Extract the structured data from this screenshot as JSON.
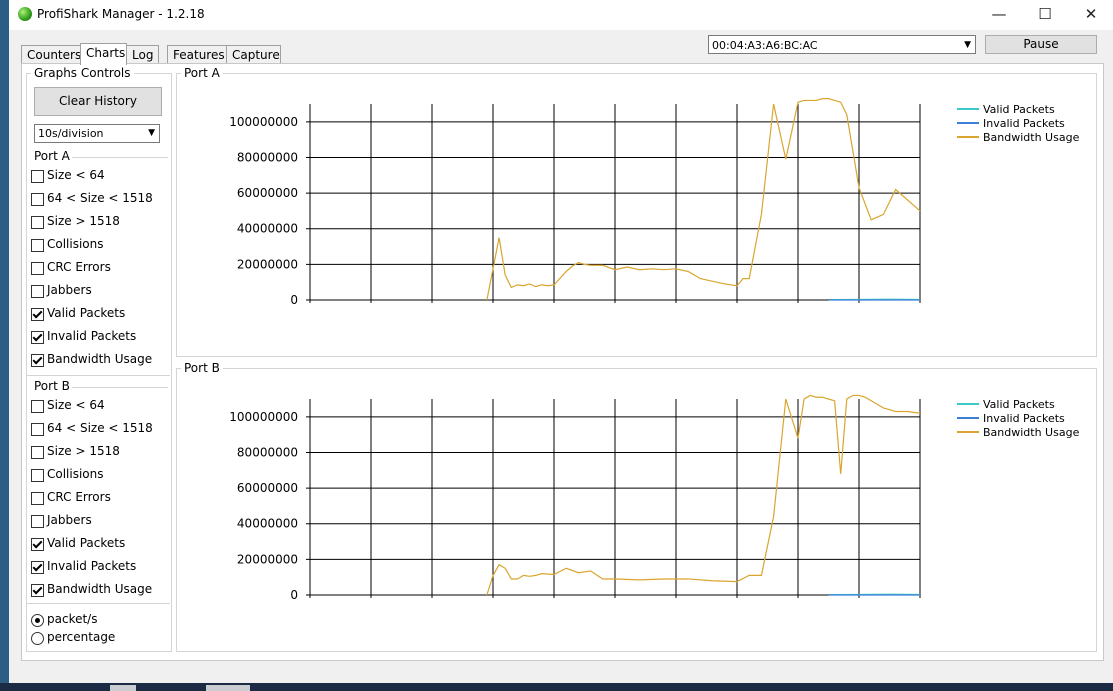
{
  "window": {
    "title": "ProfiShark Manager - 1.2.18"
  },
  "tabs": [
    {
      "label": "Counters",
      "active": false
    },
    {
      "label": "Charts",
      "active": true
    },
    {
      "label": "Log",
      "active": false
    },
    {
      "label": "Features",
      "active": false
    },
    {
      "label": "Capture",
      "active": false
    }
  ],
  "device_select": {
    "value": "00:04:A3:A6:BC:AC"
  },
  "pause_label": "Pause",
  "controls": {
    "group_title": "Graphs Controls",
    "clear_history": "Clear History",
    "division_select": "10s/division",
    "port_a": {
      "label": "Port A",
      "items": [
        {
          "label": "Size < 64",
          "checked": false
        },
        {
          "label": "64 < Size < 1518",
          "checked": false
        },
        {
          "label": "Size > 1518",
          "checked": false
        },
        {
          "label": "Collisions",
          "checked": false
        },
        {
          "label": "CRC Errors",
          "checked": false
        },
        {
          "label": "Jabbers",
          "checked": false
        },
        {
          "label": "Valid Packets",
          "checked": true
        },
        {
          "label": "Invalid Packets",
          "checked": true
        },
        {
          "label": "Bandwidth Usage",
          "checked": true
        }
      ]
    },
    "port_b": {
      "label": "Port B",
      "items": [
        {
          "label": "Size < 64",
          "checked": false
        },
        {
          "label": "64 < Size < 1518",
          "checked": false
        },
        {
          "label": "Size > 1518",
          "checked": false
        },
        {
          "label": "Collisions",
          "checked": false
        },
        {
          "label": "CRC Errors",
          "checked": false
        },
        {
          "label": "Jabbers",
          "checked": false
        },
        {
          "label": "Valid Packets",
          "checked": true
        },
        {
          "label": "Invalid Packets",
          "checked": true
        },
        {
          "label": "Bandwidth Usage",
          "checked": true
        }
      ]
    },
    "units": [
      {
        "label": "packet/s",
        "selected": true
      },
      {
        "label": "percentage",
        "selected": false
      }
    ]
  },
  "colors": {
    "valid": "#3cc8c8",
    "invalid": "#3c7fd8",
    "bandwidth": "#d9a52e"
  },
  "chart_data": [
    {
      "type": "line",
      "title": "Port A",
      "ylim": [
        0,
        110000000
      ],
      "yticks": [
        0,
        20000000,
        40000000,
        60000000,
        80000000,
        100000000
      ],
      "ytick_labels": [
        "0",
        "20000000",
        "40000000",
        "60000000",
        "80000000",
        "100000000"
      ],
      "xlim": [
        0,
        100
      ],
      "grid": true,
      "legend": "top-right",
      "series": [
        {
          "name": "Valid Packets",
          "color": "#3cc8c8",
          "x": [
            85,
            90,
            95,
            100
          ],
          "y": [
            200000,
            300000,
            400000,
            300000
          ]
        },
        {
          "name": "Invalid Packets",
          "color": "#3c7fd8",
          "x": [
            85,
            100
          ],
          "y": [
            0,
            0
          ]
        },
        {
          "name": "Bandwidth Usage",
          "color": "#d9a52e",
          "x": [
            29,
            31,
            32,
            33,
            34,
            35,
            36,
            37,
            38,
            39,
            40,
            42,
            43,
            44,
            45,
            46,
            47,
            48,
            50,
            52,
            54,
            56,
            58,
            60,
            62,
            64,
            66,
            68,
            70,
            71,
            72,
            74,
            76,
            78,
            80,
            81,
            82,
            83,
            84,
            85,
            86,
            87,
            88,
            90,
            92,
            94,
            96,
            97,
            98,
            99,
            100
          ],
          "y": [
            0,
            35000000,
            14000000,
            7000000,
            8500000,
            8000000,
            9000000,
            7500000,
            8500000,
            8000000,
            8500000,
            16000000,
            19000000,
            21000000,
            20000000,
            19500000,
            19500000,
            19500000,
            17000000,
            18500000,
            17000000,
            17500000,
            17000000,
            17500000,
            16000000,
            12000000,
            10500000,
            9000000,
            8000000,
            12000000,
            12000000,
            48000000,
            110000000,
            79000000,
            111000000,
            112000000,
            112000000,
            112000000,
            113000000,
            113000000,
            112000000,
            111000000,
            104000000,
            63000000,
            45000000,
            48000000,
            62000000,
            59000000,
            56000000,
            53000000,
            50000000
          ]
        }
      ]
    },
    {
      "type": "line",
      "title": "Port B",
      "ylim": [
        0,
        110000000
      ],
      "yticks": [
        0,
        20000000,
        40000000,
        60000000,
        80000000,
        100000000
      ],
      "ytick_labels": [
        "0",
        "20000000",
        "40000000",
        "60000000",
        "80000000",
        "100000000"
      ],
      "xlim": [
        0,
        100
      ],
      "grid": true,
      "legend": "top-right",
      "series": [
        {
          "name": "Valid Packets",
          "color": "#3cc8c8",
          "x": [
            85,
            90,
            95,
            100
          ],
          "y": [
            200000,
            300000,
            400000,
            300000
          ]
        },
        {
          "name": "Invalid Packets",
          "color": "#3c7fd8",
          "x": [
            85,
            100
          ],
          "y": [
            0,
            0
          ]
        },
        {
          "name": "Bandwidth Usage",
          "color": "#d9a52e",
          "x": [
            29,
            30,
            31,
            32,
            33,
            34,
            35,
            36,
            37,
            38,
            40,
            42,
            44,
            46,
            48,
            50,
            54,
            58,
            62,
            66,
            70,
            72,
            74,
            76,
            78,
            80,
            81,
            82,
            83,
            84,
            85,
            86,
            87,
            88,
            89,
            90,
            91,
            92,
            93,
            94,
            95,
            96,
            97,
            98,
            100
          ],
          "y": [
            0,
            11000000,
            17000000,
            15000000,
            9000000,
            9000000,
            11000000,
            10500000,
            11000000,
            12000000,
            11500000,
            15000000,
            12500000,
            13500000,
            9000000,
            9000000,
            8500000,
            9000000,
            9000000,
            8000000,
            7500000,
            11000000,
            11000000,
            44000000,
            110000000,
            88000000,
            110000000,
            112000000,
            111000000,
            111000000,
            110000000,
            109000000,
            68000000,
            110000000,
            112000000,
            112000000,
            111000000,
            109000000,
            107000000,
            105000000,
            104000000,
            103000000,
            103000000,
            103000000,
            102000000
          ]
        }
      ]
    }
  ]
}
